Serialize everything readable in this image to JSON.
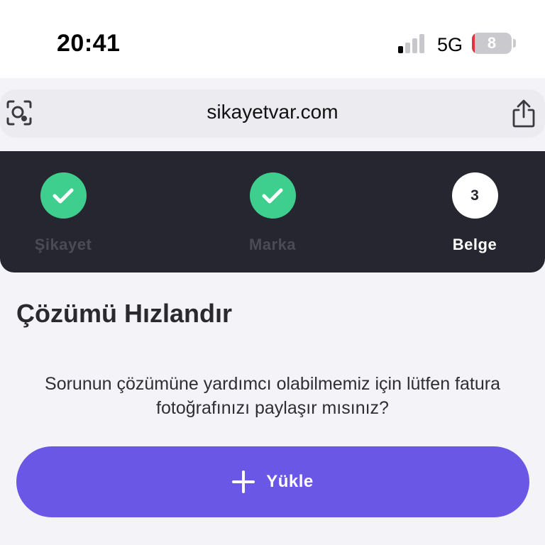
{
  "status_bar": {
    "time": "20:41",
    "network": "5G",
    "battery_level": "8",
    "battery_fraction": 0.08,
    "signal_bars_active": 1,
    "signal_bars_total": 4
  },
  "browser": {
    "url": "sikayetvar.com",
    "left_icon": "lens-icon",
    "right_icon": "share-icon"
  },
  "stepper": {
    "steps": [
      {
        "label": "Şikayet",
        "state": "done",
        "icon": "check-icon"
      },
      {
        "label": "Marka",
        "state": "done",
        "icon": "check-icon"
      },
      {
        "label": "Belge",
        "state": "current",
        "number": "3"
      }
    ],
    "colors": {
      "done": "#3ecf8e",
      "background": "#262631"
    }
  },
  "content": {
    "title": "Çözümü Hızlandır",
    "description": "Sorunun çözümüne yardımcı olabilmemiz için lütfen fatura fotoğrafınızı paylaşır mısınız?",
    "upload_button": {
      "label": "Yükle",
      "icon": "plus-icon",
      "color": "#6b57e6"
    }
  }
}
